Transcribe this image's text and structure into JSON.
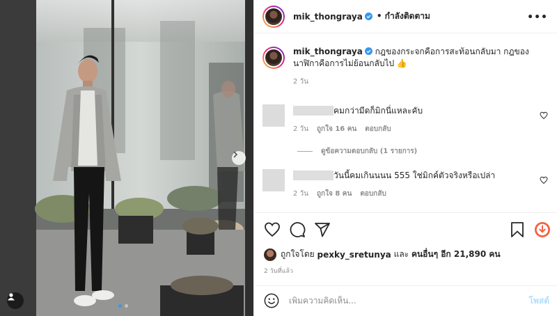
{
  "post": {
    "username": "mik_thongraya",
    "follow_status": "• กำลังติดตาม",
    "more_icon": "more-horizontal-icon",
    "caption": "กฎของกระจกคือการสะท้อนกลับมา กฎของนาฬิกาคือการไม่ย้อนกลับไป 👍",
    "caption_time": "2 วัน"
  },
  "comments": [
    {
      "text": "คมกว่ามีดก็มิกนี่แหละคับ",
      "time": "2 วัน",
      "likes": "ถูกใจ 16 คน",
      "reply": "ตอบกลับ",
      "view_replies": "ดูข้อความตอบกลับ (1 รายการ)"
    },
    {
      "text": "วันนี้คมเกินนนน 555 ใช่มิกค์ตัวจริงหรือเปล่า",
      "time": "2 วัน",
      "likes": "ถูกใจ 8 คน",
      "reply": "ตอบกลับ"
    }
  ],
  "likes_summary": {
    "prefix": "ถูกใจโดย",
    "user": "pexky_sretunya",
    "middle": "และ",
    "others": "คนอื่นๆ อีก 21,890 คน"
  },
  "posted_time": "2 วันที่แล้ว",
  "add_comment": {
    "placeholder": "เพิ่มความคิดเห็น...",
    "post_label": "โพสต์"
  },
  "carousel": {
    "slide_count": 2,
    "active_index": 0
  },
  "colors": {
    "verified": "#3897f0",
    "post_disabled": "#b2dffc",
    "save_badge": "#f56040"
  }
}
